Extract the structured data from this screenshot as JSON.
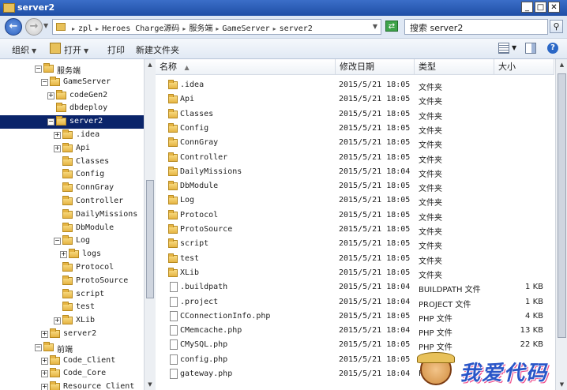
{
  "window": {
    "title": "server2"
  },
  "address": {
    "breadcrumbs": [
      "zpl",
      "Heroes Charge源码",
      "服务端",
      "GameServer",
      "server2"
    ],
    "search_placeholder": "搜索 server2"
  },
  "toolbar": {
    "organize": "组织",
    "open": "打开",
    "print": "打印",
    "new_folder": "新建文件夹"
  },
  "tree": [
    {
      "label": "服务端",
      "expander": "−",
      "depth": 0
    },
    {
      "label": "GameServer",
      "expander": "−",
      "depth": 1
    },
    {
      "label": "codeGen2",
      "expander": "+",
      "depth": 2
    },
    {
      "label": "dbdeploy",
      "expander": "",
      "depth": 2
    },
    {
      "label": "server2",
      "expander": "−",
      "depth": 2,
      "selected": true
    },
    {
      "label": ".idea",
      "expander": "+",
      "depth": 3
    },
    {
      "label": "Api",
      "expander": "+",
      "depth": 3
    },
    {
      "label": "Classes",
      "expander": "",
      "depth": 3
    },
    {
      "label": "Config",
      "expander": "",
      "depth": 3
    },
    {
      "label": "ConnGray",
      "expander": "",
      "depth": 3
    },
    {
      "label": "Controller",
      "expander": "",
      "depth": 3
    },
    {
      "label": "DailyMissions",
      "expander": "",
      "depth": 3
    },
    {
      "label": "DbModule",
      "expander": "",
      "depth": 3
    },
    {
      "label": "Log",
      "expander": "−",
      "depth": 3
    },
    {
      "label": "logs",
      "expander": "+",
      "depth": 4
    },
    {
      "label": "Protocol",
      "expander": "",
      "depth": 3
    },
    {
      "label": "ProtoSource",
      "expander": "",
      "depth": 3
    },
    {
      "label": "script",
      "expander": "",
      "depth": 3
    },
    {
      "label": "test",
      "expander": "",
      "depth": 3
    },
    {
      "label": "XLib",
      "expander": "+",
      "depth": 3
    },
    {
      "label": "server2",
      "expander": "+",
      "depth": 1
    },
    {
      "label": "前端",
      "expander": "−",
      "depth": 0
    },
    {
      "label": "Code_Client",
      "expander": "+",
      "depth": 1
    },
    {
      "label": "Code_Core",
      "expander": "+",
      "depth": 1
    },
    {
      "label": "Resource_Client",
      "expander": "+",
      "depth": 1
    }
  ],
  "columns": {
    "name": "名称",
    "date": "修改日期",
    "type": "类型",
    "size": "大小"
  },
  "files": [
    {
      "name": ".idea",
      "date": "2015/5/21 18:05",
      "type": "文件夹",
      "size": "",
      "kind": "folder"
    },
    {
      "name": "Api",
      "date": "2015/5/21 18:05",
      "type": "文件夹",
      "size": "",
      "kind": "folder"
    },
    {
      "name": "Classes",
      "date": "2015/5/21 18:05",
      "type": "文件夹",
      "size": "",
      "kind": "folder"
    },
    {
      "name": "Config",
      "date": "2015/5/21 18:05",
      "type": "文件夹",
      "size": "",
      "kind": "folder"
    },
    {
      "name": "ConnGray",
      "date": "2015/5/21 18:05",
      "type": "文件夹",
      "size": "",
      "kind": "folder"
    },
    {
      "name": "Controller",
      "date": "2015/5/21 18:05",
      "type": "文件夹",
      "size": "",
      "kind": "folder"
    },
    {
      "name": "DailyMissions",
      "date": "2015/5/21 18:04",
      "type": "文件夹",
      "size": "",
      "kind": "folder"
    },
    {
      "name": "DbModule",
      "date": "2015/5/21 18:05",
      "type": "文件夹",
      "size": "",
      "kind": "folder"
    },
    {
      "name": "Log",
      "date": "2015/5/21 18:05",
      "type": "文件夹",
      "size": "",
      "kind": "folder"
    },
    {
      "name": "Protocol",
      "date": "2015/5/21 18:05",
      "type": "文件夹",
      "size": "",
      "kind": "folder"
    },
    {
      "name": "ProtoSource",
      "date": "2015/5/21 18:05",
      "type": "文件夹",
      "size": "",
      "kind": "folder"
    },
    {
      "name": "script",
      "date": "2015/5/21 18:05",
      "type": "文件夹",
      "size": "",
      "kind": "folder"
    },
    {
      "name": "test",
      "date": "2015/5/21 18:05",
      "type": "文件夹",
      "size": "",
      "kind": "folder"
    },
    {
      "name": "XLib",
      "date": "2015/5/21 18:05",
      "type": "文件夹",
      "size": "",
      "kind": "folder"
    },
    {
      "name": ".buildpath",
      "date": "2015/5/21 18:04",
      "type": "BUILDPATH 文件",
      "size": "1 KB",
      "kind": "file"
    },
    {
      "name": ".project",
      "date": "2015/5/21 18:04",
      "type": "PROJECT 文件",
      "size": "1 KB",
      "kind": "file"
    },
    {
      "name": "CConnectionInfo.php",
      "date": "2015/5/21 18:05",
      "type": "PHP 文件",
      "size": "4 KB",
      "kind": "file"
    },
    {
      "name": "CMemcache.php",
      "date": "2015/5/21 18:04",
      "type": "PHP 文件",
      "size": "13 KB",
      "kind": "file"
    },
    {
      "name": "CMySQL.php",
      "date": "2015/5/21 18:05",
      "type": "PHP 文件",
      "size": "22 KB",
      "kind": "file"
    },
    {
      "name": "config.php",
      "date": "2015/5/21 18:05",
      "type": "P",
      "size": "",
      "kind": "file"
    },
    {
      "name": "gateway.php",
      "date": "2015/5/21 18:04",
      "type": "PH",
      "size": "",
      "kind": "file"
    }
  ],
  "watermark": {
    "text": "我爱代码"
  }
}
